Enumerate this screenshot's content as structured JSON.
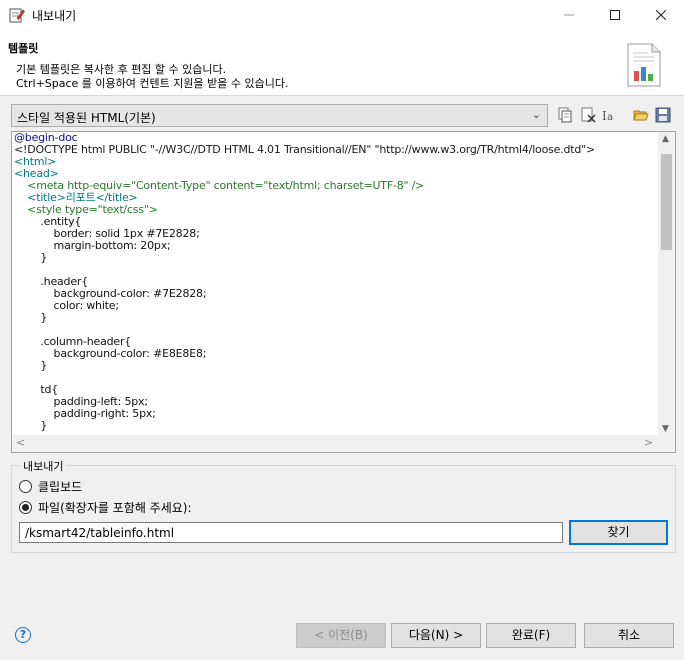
{
  "window": {
    "title": "내보내기"
  },
  "banner": {
    "title": "템플릿",
    "description": "기본 템플릿은 복사한 후 편집 할 수 있습니다.\nCtrl+Space 를 이용하여 컨텐트 지원을 받을 수 있습니다."
  },
  "template": {
    "selected": "스타일 적용된 HTML(기본)"
  },
  "toolbar_icons": [
    "copy-icon",
    "delete-icon",
    "rename-icon",
    "open-folder-icon",
    "save-icon"
  ],
  "editor": {
    "lines": [
      {
        "text": "@begin-doc",
        "color": "#0b0b8a"
      },
      {
        "text": "<!DOCTYPE html PUBLIC \"-//W3C//DTD HTML 4.01 Transitional//EN\" \"http://www.w3.org/TR/html4/loose.dtd\">",
        "color": "#1a1a1a"
      },
      {
        "text": "<html>",
        "color": "#007a7a"
      },
      {
        "text": "<head>",
        "color": "#007a7a"
      },
      {
        "text": "    <meta http-equiv=\"Content-Type\" content=\"text/html; charset=UTF-8\" />",
        "color": "#2a7a2a"
      },
      {
        "text": "    <title>리포트</title>",
        "color": "#007a7a"
      },
      {
        "text": "    <style type=\"text/css\">",
        "color": "#2a7a2a"
      },
      {
        "text": "        .entity{",
        "color": "#111111"
      },
      {
        "text": "            border: solid 1px #7E2828;",
        "color": "#111111"
      },
      {
        "text": "            margin-bottom: 20px;",
        "color": "#111111"
      },
      {
        "text": "        }",
        "color": "#111111"
      },
      {
        "text": "",
        "color": "#111111"
      },
      {
        "text": "        .header{",
        "color": "#111111"
      },
      {
        "text": "            background-color: #7E2828;",
        "color": "#111111"
      },
      {
        "text": "            color: white;",
        "color": "#111111"
      },
      {
        "text": "        }",
        "color": "#111111"
      },
      {
        "text": "",
        "color": "#111111"
      },
      {
        "text": "        .column-header{",
        "color": "#111111"
      },
      {
        "text": "            background-color: #E8E8E8;",
        "color": "#111111"
      },
      {
        "text": "        }",
        "color": "#111111"
      },
      {
        "text": "",
        "color": "#111111"
      },
      {
        "text": "        td{",
        "color": "#111111"
      },
      {
        "text": "            padding-left: 5px;",
        "color": "#111111"
      },
      {
        "text": "            padding-right: 5px;",
        "color": "#111111"
      },
      {
        "text": "        }",
        "color": "#111111"
      }
    ]
  },
  "export": {
    "group_label": "내보내기",
    "clipboard_label": "클립보드",
    "clipboard_checked": false,
    "file_label": "파일(확장자를 포함해 주세요):",
    "file_checked": true,
    "file_path": "/ksmart42/tableinfo.html",
    "browse_label": "찾기"
  },
  "footer": {
    "back_label": "< 이전(B)",
    "next_label": "다음(N) >",
    "finish_label": "완료(F)",
    "cancel_label": "취소"
  },
  "colors": {
    "accent": "#0078d7"
  }
}
